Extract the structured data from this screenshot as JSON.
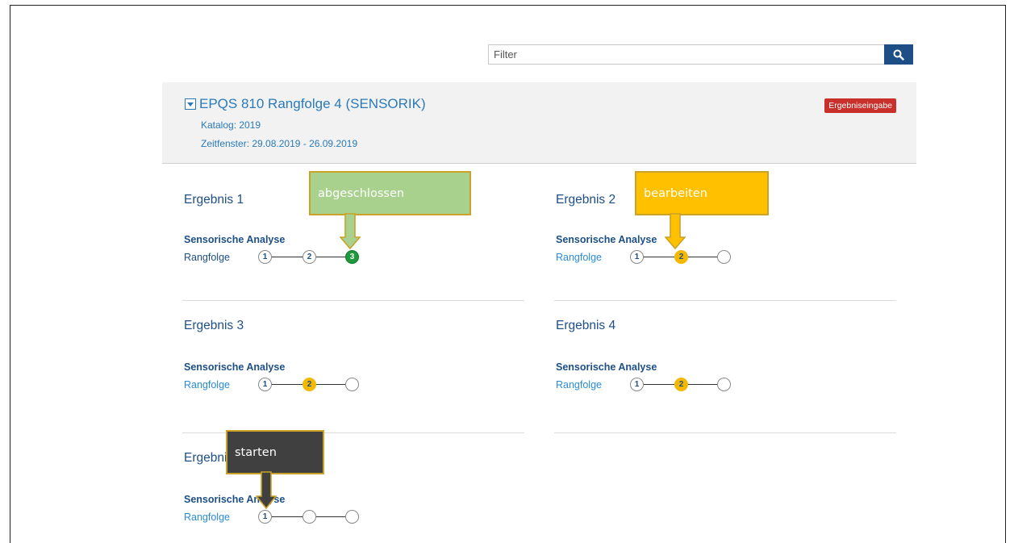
{
  "filter": {
    "placeholder": "Filter",
    "button_icon": "search-icon"
  },
  "header": {
    "title": "EPQS 810 Rangfolge 4 (SENSORIK)",
    "katalog": "Katalog: 2019",
    "zeitfenster": "Zeitfenster: 29.08.2019 - 26.09.2019",
    "badge": "Ergebniseingabe",
    "badge_color": "#c9302c"
  },
  "results": [
    {
      "title": "Ergebnis 1",
      "subtitle": "Sensorische Analyse",
      "link": "Rangfolge",
      "steps": [
        {
          "label": "1",
          "state": "visited"
        },
        {
          "label": "2",
          "state": "visited"
        },
        {
          "label": "3",
          "state": "done"
        }
      ]
    },
    {
      "title": "Ergebnis 2",
      "subtitle": "Sensorische Analyse",
      "link": "Rangfolge",
      "steps": [
        {
          "label": "1",
          "state": "visited"
        },
        {
          "label": "2",
          "state": "current"
        },
        {
          "label": "",
          "state": "empty"
        }
      ]
    },
    {
      "title": "Ergebnis 3",
      "subtitle": "Sensorische Analyse",
      "link": "Rangfolge",
      "steps": [
        {
          "label": "1",
          "state": "visited"
        },
        {
          "label": "2",
          "state": "current"
        },
        {
          "label": "",
          "state": "empty"
        }
      ]
    },
    {
      "title": "Ergebnis 4",
      "subtitle": "Sensorische Analyse",
      "link": "Rangfolge",
      "steps": [
        {
          "label": "1",
          "state": "visited"
        },
        {
          "label": "2",
          "state": "current"
        },
        {
          "label": "",
          "state": "empty"
        }
      ]
    },
    {
      "title": "Ergebnis 5",
      "subtitle": "Sensorische Analyse",
      "link": "Rangfolge",
      "steps": [
        {
          "label": "1",
          "state": "visited"
        },
        {
          "label": "",
          "state": "empty"
        },
        {
          "label": "",
          "state": "empty"
        }
      ]
    }
  ],
  "callouts": {
    "abgeschlossen": {
      "text": "abgeschlossen",
      "color": "#a9d18e",
      "border": "#c9a227"
    },
    "bearbeiten": {
      "text": "bearbeiten",
      "color": "#ffc000",
      "border": "#c9a227"
    },
    "starten": {
      "text": "starten",
      "color": "#404040",
      "border": "#c9a227"
    }
  }
}
